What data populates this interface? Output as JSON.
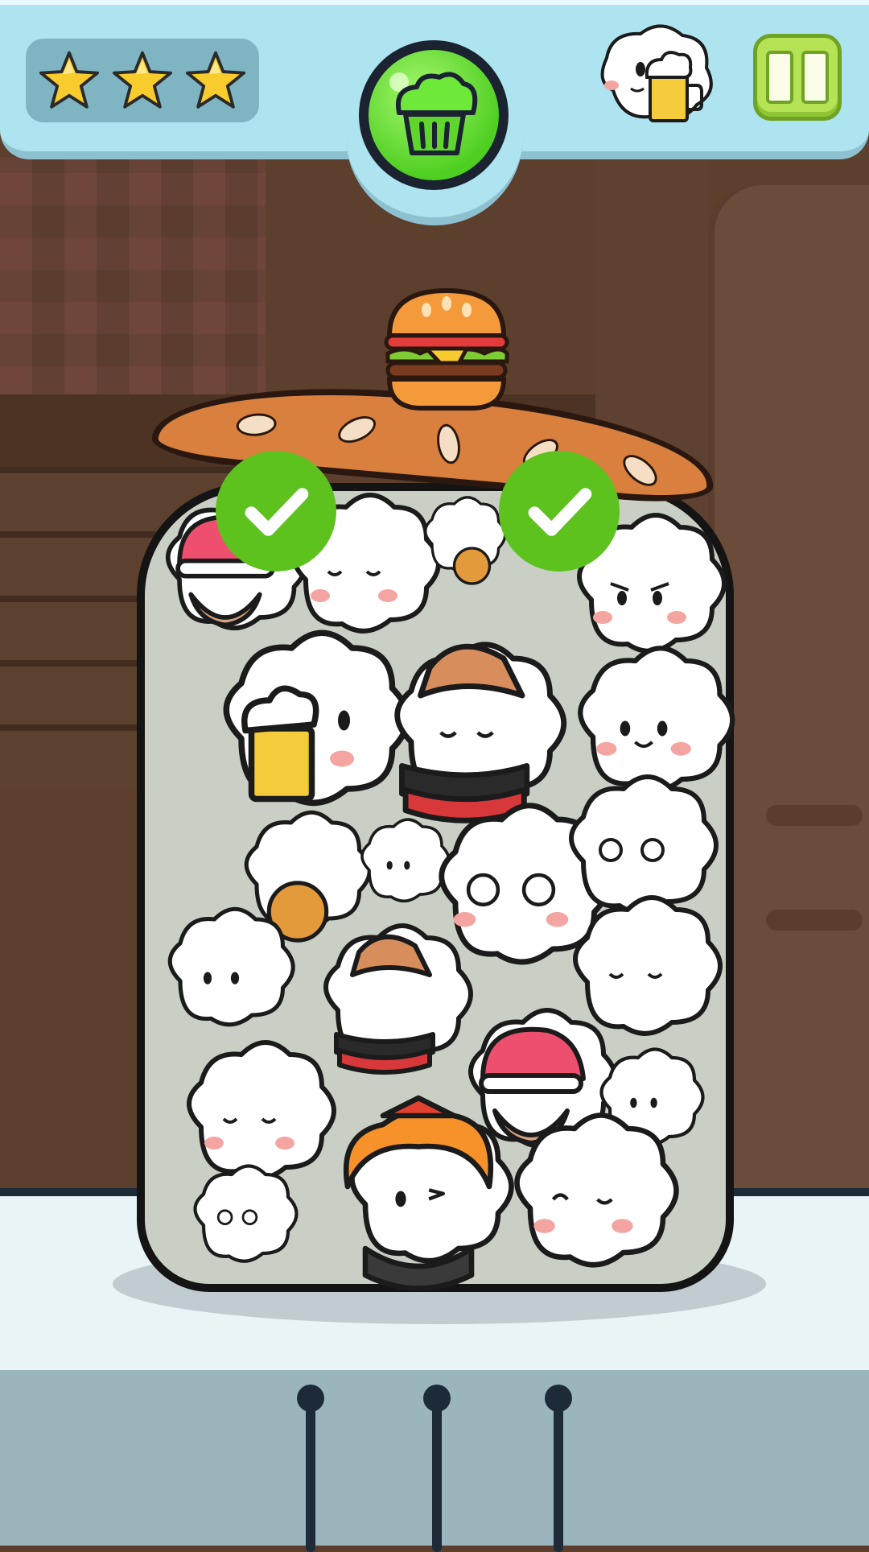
{
  "hud": {
    "stars_earned": 3,
    "stars_total": 3,
    "goal_icon": "muffin-icon",
    "target_icon": "beer-cloud-icon",
    "pause_icon": "pause-icon"
  },
  "jar": {
    "lid_item": "burger-icon",
    "completed_checks": 2
  },
  "colors": {
    "hud_bg": "#aee3f0",
    "goal_green": "#4fcf22",
    "check_green": "#5dc11e",
    "pause_green": "#b6e255",
    "lid_orange": "#d9803e"
  },
  "characters": [
    {
      "type": "cloud-santa-hat-grandpa"
    },
    {
      "type": "cloud-happy"
    },
    {
      "type": "cloud-pretzel-small"
    },
    {
      "type": "cloud-angry"
    },
    {
      "type": "cloud-beer-big"
    },
    {
      "type": "cloud-german-hat"
    },
    {
      "type": "cloud-smile"
    },
    {
      "type": "cloud-pretzel"
    },
    {
      "type": "cloud-small-smile"
    },
    {
      "type": "cloud-dizzy-big"
    },
    {
      "type": "cloud-dizzy"
    },
    {
      "type": "cloud-angry-small"
    },
    {
      "type": "cloud-german-hat-2"
    },
    {
      "type": "cloud-happy-2"
    },
    {
      "type": "cloud-happy-3"
    },
    {
      "type": "cloud-santa-hat-grandpa-2"
    },
    {
      "type": "cloud-small-smile-2"
    },
    {
      "type": "cloud-dizzy-small"
    },
    {
      "type": "cloud-dirndl-wink"
    },
    {
      "type": "cloud-wink"
    }
  ]
}
